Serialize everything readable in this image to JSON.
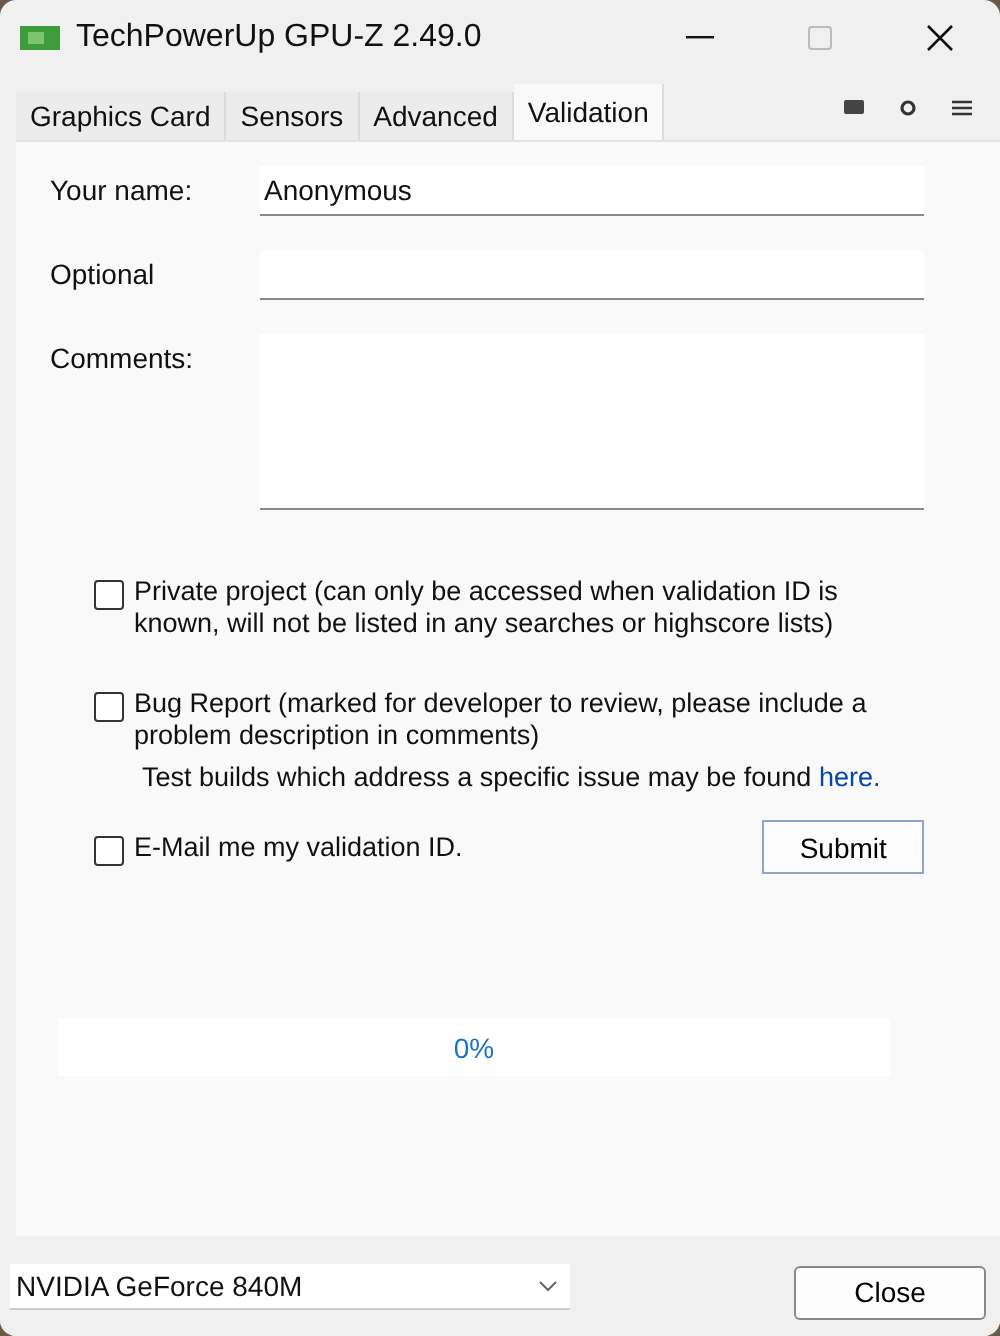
{
  "window": {
    "title": "TechPowerUp GPU-Z 2.49.0"
  },
  "tabs": [
    {
      "label": "Graphics Card",
      "selected": false
    },
    {
      "label": "Sensors",
      "selected": false
    },
    {
      "label": "Advanced",
      "selected": false
    },
    {
      "label": "Validation",
      "selected": true
    }
  ],
  "fields": [
    {
      "label": "Your name:",
      "value": "Anonymous",
      "kind": "line"
    },
    {
      "label": "Optional",
      "kind": "line"
    },
    {
      "label": "Comments:",
      "kind": "area"
    }
  ],
  "options": [
    {
      "text": "Private project (can only be accessed when validation ID is known, will not be listed in any searches or highscore lists)",
      "checked": false
    },
    {
      "text": "Bug Report (marked for developer to review, please include a problem description in comments)",
      "checked": false,
      "note": "Test builds which address a specific issue may be found",
      "link": "here."
    },
    {
      "text": "E-Mail me my validation ID.",
      "checked": false
    }
  ],
  "submit_button": "Submit",
  "progress": {
    "reading": "0%"
  },
  "gpu_select": {
    "value": "NVIDIA GeForce 840M"
  },
  "close_button": "Close"
}
